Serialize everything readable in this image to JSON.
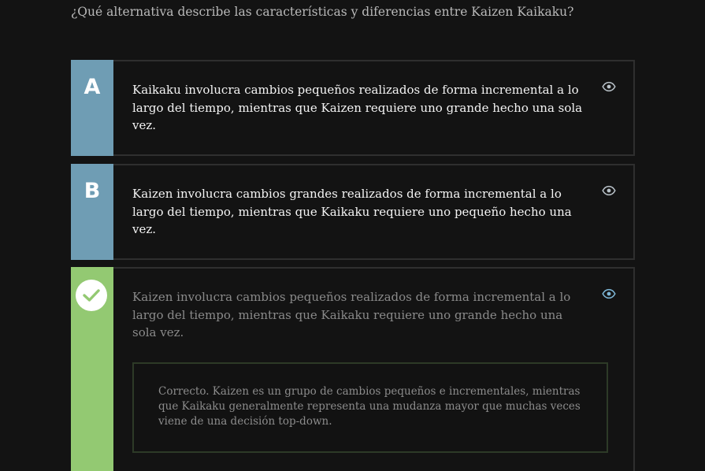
{
  "question": "¿Qué alternativa describe las características y diferencias entre Kaizen Kaikaku?",
  "options": [
    {
      "letter": "A",
      "text": "Kaikaku involucra cambios pequeños realizados de forma incremental a lo largo del tiempo, mientras que Kaizen requiere uno grande hecho una sola vez.",
      "state": "default",
      "icon": "eye-icon"
    },
    {
      "letter": "B",
      "text": "Kaizen involucra cambios grandes realizados de forma incremental a lo largo del tiempo, mientras que Kaikaku requiere uno pequeño hecho una vez.",
      "state": "default",
      "icon": "eye-icon"
    },
    {
      "letter": "",
      "text": "Kaizen involucra cambios pequeños realizados de forma incremental a lo largo del tiempo, mientras que Kaikaku requiere uno grande hecho una sola vez.",
      "state": "correct",
      "icon": "eye-icon",
      "feedback": "Correcto. Kaizen es un grupo de cambios pequeños e incrementales, mientras que Kaikaku generalmente representa una mudanza mayor que muchas veces viene de una decisión top-down."
    }
  ],
  "colors": {
    "background": "#131313",
    "option_letter_bg": "#6f9db4",
    "correct_bg": "#93c972",
    "eye_default": "#b9c2c9",
    "eye_active": "#7fb8d8",
    "feedback_border": "#2d3a27"
  }
}
